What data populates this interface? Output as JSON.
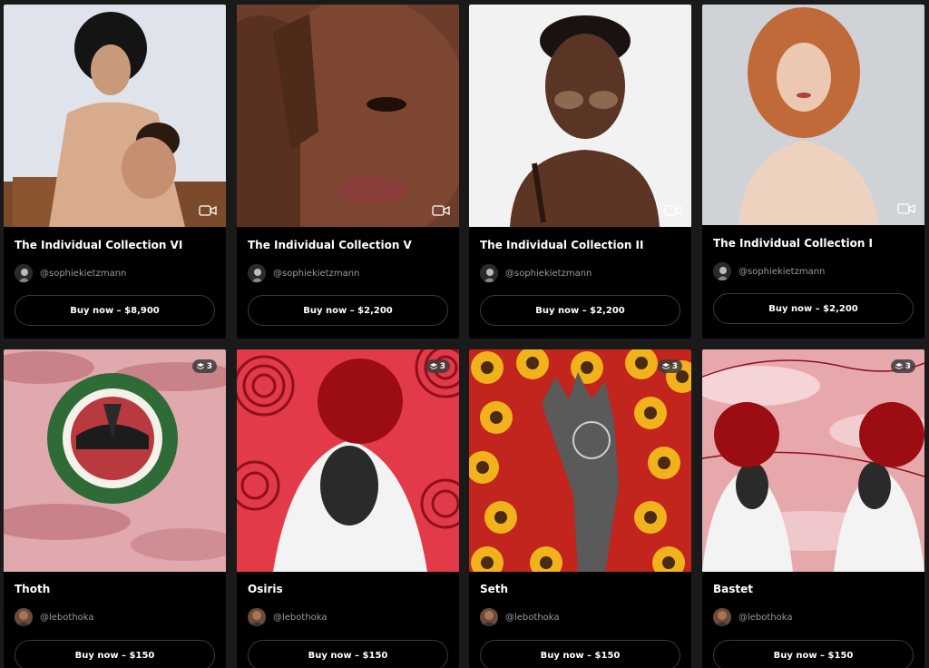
{
  "colors": {
    "background": "#1a1a1a",
    "card": "#000000",
    "accent_red": "#9b0d12",
    "muted_text": "#9a9a9a"
  },
  "icons": {
    "video": "video-camera-icon",
    "edition": "stack-icon"
  },
  "cards": [
    {
      "title": "The Individual Collection VI",
      "handle": "@sophiekietzmann",
      "buy_label": "Buy now – $8,900"
    },
    {
      "title": "The Individual Collection V",
      "handle": "@sophiekietzmann",
      "buy_label": "Buy now – $2,200"
    },
    {
      "title": "The Individual Collection II",
      "handle": "@sophiekietzmann",
      "buy_label": "Buy now – $2,200"
    },
    {
      "title": "The Individual Collection I",
      "handle": "@sophiekietzmann",
      "buy_label": "Buy now – $2,200"
    },
    {
      "title": "Thoth",
      "handle": "@lebothoka",
      "buy_label": "Buy now – $150",
      "edition_count": "3"
    },
    {
      "title": "Osiris",
      "handle": "@lebothoka",
      "buy_label": "Buy now – $150",
      "edition_count": "3"
    },
    {
      "title": "Seth",
      "handle": "@lebothoka",
      "buy_label": "Buy now – $150",
      "edition_count": "3"
    },
    {
      "title": "Bastet",
      "handle": "@lebothoka",
      "buy_label": "Buy now – $150",
      "edition_count": "3"
    }
  ]
}
